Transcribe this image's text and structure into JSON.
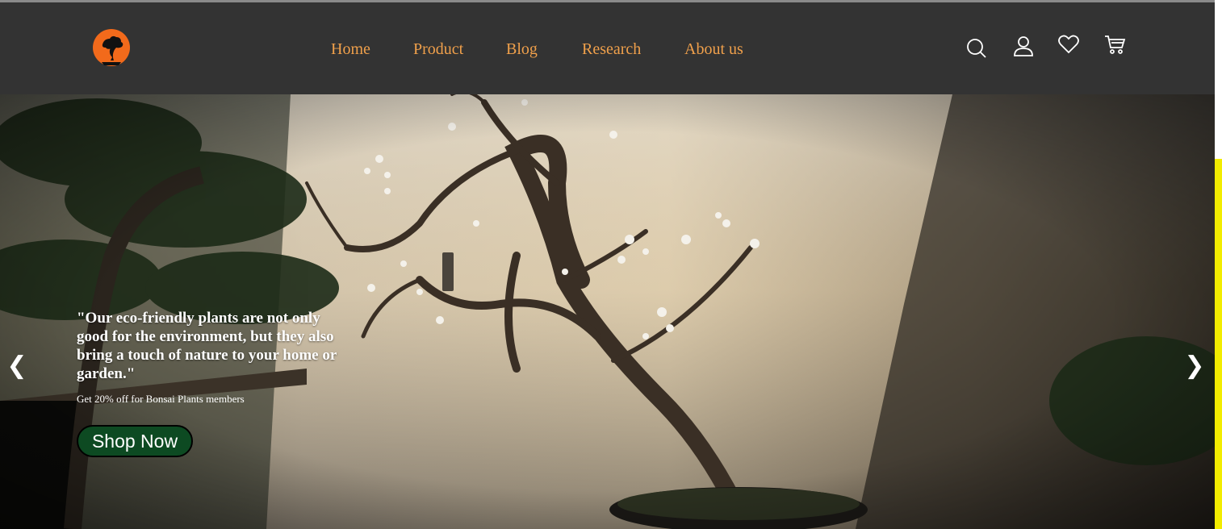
{
  "nav": {
    "items": [
      {
        "label": "Home"
      },
      {
        "label": "Product"
      },
      {
        "label": "Blog"
      },
      {
        "label": "Research"
      },
      {
        "label": "About us"
      }
    ]
  },
  "header_icons": [
    "search-icon",
    "user-icon",
    "heart-icon",
    "cart-icon"
  ],
  "hero": {
    "quote": "\"Our eco-friendly plants are not only good for the environment, but they also bring a touch of nature to your home or garden.\"",
    "promo": "Get 20% off for Bonsai Plants members",
    "cta": "Shop Now",
    "prev": "❮",
    "next": "❯"
  },
  "colors": {
    "header_bg": "#333333",
    "nav_text": "#f0a04b",
    "logo_orange": "#f26a1b",
    "cta_bg": "#0d4a22",
    "side_accent": "#f2ec00"
  }
}
